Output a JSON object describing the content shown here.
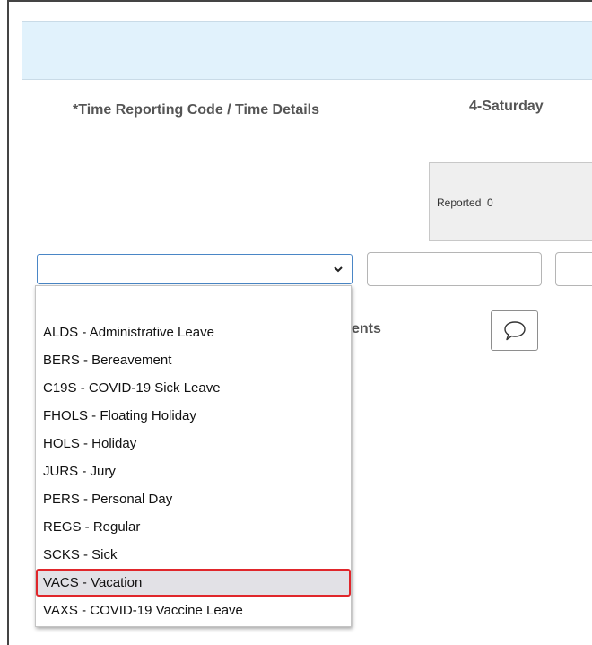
{
  "header": {
    "trc_column": "*Time Reporting Code / Time Details",
    "day_column": "4-Saturday"
  },
  "summary": {
    "reported_label": "Reported",
    "reported_value": "0"
  },
  "comments": {
    "label_fragment": "ents"
  },
  "dropdown": {
    "selected_value": "",
    "options": [
      {
        "label": "ALDS - Administrative Leave"
      },
      {
        "label": "BERS - Bereavement"
      },
      {
        "label": "C19S - COVID-19 Sick Leave"
      },
      {
        "label": "FHOLS - Floating Holiday"
      },
      {
        "label": "HOLS - Holiday"
      },
      {
        "label": "JURS - Jury"
      },
      {
        "label": "PERS - Personal Day"
      },
      {
        "label": "REGS - Regular"
      },
      {
        "label": "SCKS - Sick"
      },
      {
        "label": "VACS - Vacation"
      },
      {
        "label": "VAXS - COVID-19 Vaccine Leave"
      }
    ],
    "highlighted_label": "VACS - Vacation",
    "highlight_color": "#e0262b"
  },
  "colors": {
    "band": "#e1f2fc",
    "select_border": "#4a86c6"
  },
  "icons": [
    "chevron-down-icon",
    "speech-bubble-icon"
  ]
}
